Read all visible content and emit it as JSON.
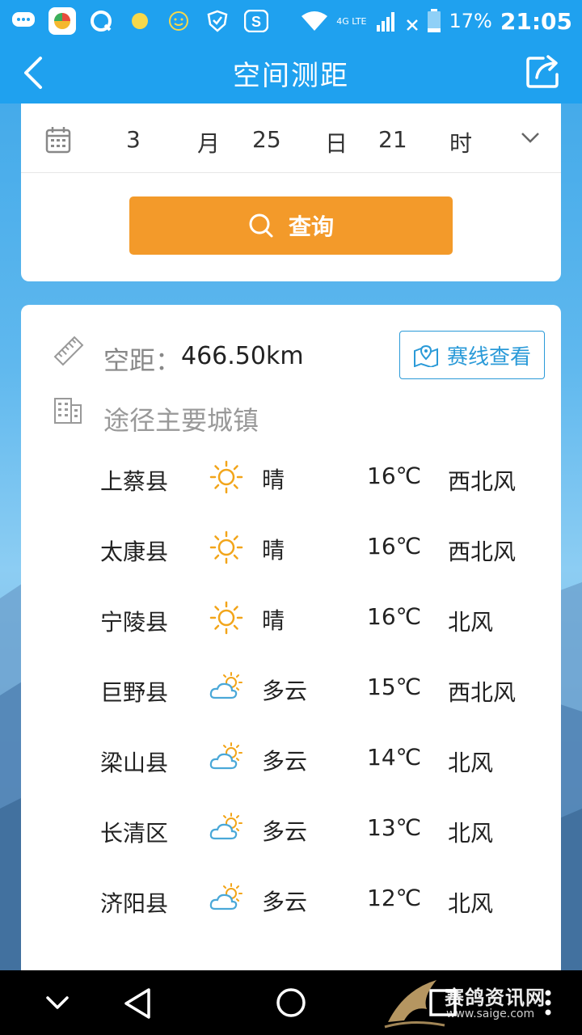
{
  "status_bar": {
    "network": "4G LTE",
    "battery": "17%",
    "time": "21:05"
  },
  "nav": {
    "title": "空间测距"
  },
  "date_picker": {
    "month": "3",
    "month_unit": "月",
    "day": "25",
    "day_unit": "日",
    "hour": "21",
    "hour_unit": "时"
  },
  "query_button": {
    "label": "查询"
  },
  "distance": {
    "label": "空距：",
    "value": "466.50km",
    "route_button": "赛线查看"
  },
  "towns_label": "途径主要城镇",
  "cities": [
    {
      "name": "上蔡县",
      "weather": "晴",
      "icon": "sun-icon",
      "temp": "16℃",
      "wind": "西北风"
    },
    {
      "name": "太康县",
      "weather": "晴",
      "icon": "sun-icon",
      "temp": "16℃",
      "wind": "西北风"
    },
    {
      "name": "宁陵县",
      "weather": "晴",
      "icon": "sun-icon",
      "temp": "16℃",
      "wind": "北风"
    },
    {
      "name": "巨野县",
      "weather": "多云",
      "icon": "cloudy-icon",
      "temp": "15℃",
      "wind": "西北风"
    },
    {
      "name": "梁山县",
      "weather": "多云",
      "icon": "cloudy-icon",
      "temp": "14℃",
      "wind": "北风"
    },
    {
      "name": "长清区",
      "weather": "多云",
      "icon": "cloudy-icon",
      "temp": "13℃",
      "wind": "北风"
    },
    {
      "name": "济阳县",
      "weather": "多云",
      "icon": "cloudy-icon",
      "temp": "12℃",
      "wind": "北风"
    }
  ],
  "watermark": {
    "main": "赛鸽资讯网",
    "url": "www.saige.com"
  },
  "colors": {
    "primary": "#1fa1ef",
    "query_button": "#f39a2a",
    "route_button": "#2a9ad8",
    "sun": "#f2a51a",
    "cloud": "#4aa8d8"
  }
}
